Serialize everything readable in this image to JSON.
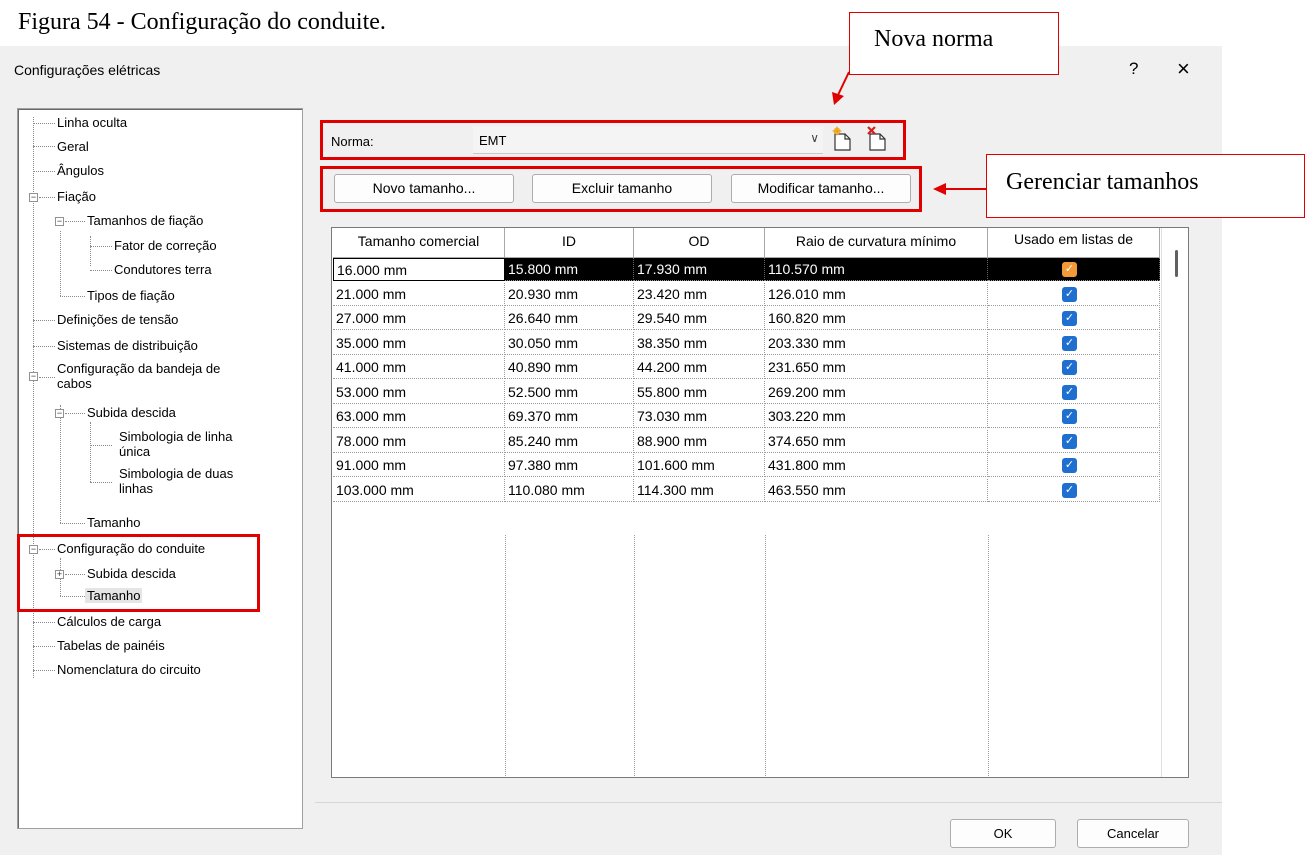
{
  "caption": "Figura 54 - Configuração do conduite.",
  "dialog": {
    "title": "Configurações elétricas",
    "help": "?",
    "close": "×"
  },
  "tree": {
    "items": [
      {
        "label": "Linha oculta"
      },
      {
        "label": "Geral"
      },
      {
        "label": "Ângulos"
      },
      {
        "label": "Fiação"
      },
      {
        "label": "Tamanhos de fiação"
      },
      {
        "label": "Fator de correção"
      },
      {
        "label": "Condutores terra"
      },
      {
        "label": "Tipos de fiação"
      },
      {
        "label": "Definições de tensão"
      },
      {
        "label": "Sistemas de distribuição"
      },
      {
        "label_line1": "Configuração da bandeja de",
        "label_line2": "cabos"
      },
      {
        "label": "Subida descida"
      },
      {
        "label_line1": "Simbologia de linha",
        "label_line2": "única"
      },
      {
        "label_line1": "Simbologia de duas",
        "label_line2": "linhas"
      },
      {
        "label": "Tamanho"
      },
      {
        "label": "Configuração do conduite"
      },
      {
        "label": "Subida descida"
      },
      {
        "label": "Tamanho",
        "selected": true
      },
      {
        "label": "Cálculos de carga"
      },
      {
        "label": "Tabelas de painéis"
      },
      {
        "label": "Nomenclatura do circuito"
      }
    ]
  },
  "norma": {
    "label": "Norma:",
    "value": "EMT",
    "new_icon": "new-norm-icon",
    "delete_icon": "delete-norm-icon"
  },
  "buttons": {
    "new_size": "Novo tamanho...",
    "delete_size": "Excluir tamanho",
    "modify_size": "Modificar tamanho..."
  },
  "table": {
    "headers": [
      "Tamanho comercial",
      "ID",
      "OD",
      "Raio de curvatura mínimo",
      "Usado em listas de"
    ],
    "rows": [
      {
        "size": "16.000 mm",
        "id": "15.800 mm",
        "od": "17.930 mm",
        "radius": "110.570 mm",
        "used": true
      },
      {
        "size": "21.000 mm",
        "id": "20.930 mm",
        "od": "23.420 mm",
        "radius": "126.010 mm",
        "used": true
      },
      {
        "size": "27.000 mm",
        "id": "26.640 mm",
        "od": "29.540 mm",
        "radius": "160.820 mm",
        "used": true
      },
      {
        "size": "35.000 mm",
        "id": "30.050 mm",
        "od": "38.350 mm",
        "radius": "203.330 mm",
        "used": true
      },
      {
        "size": "41.000 mm",
        "id": "40.890 mm",
        "od": "44.200 mm",
        "radius": "231.650 mm",
        "used": true
      },
      {
        "size": "53.000 mm",
        "id": "52.500 mm",
        "od": "55.800 mm",
        "radius": "269.200 mm",
        "used": true
      },
      {
        "size": "63.000 mm",
        "id": "69.370 mm",
        "od": "73.030 mm",
        "radius": "303.220 mm",
        "used": true
      },
      {
        "size": "78.000 mm",
        "id": "85.240 mm",
        "od": "88.900 mm",
        "radius": "374.650 mm",
        "used": true
      },
      {
        "size": "91.000 mm",
        "id": "97.380 mm",
        "od": "101.600 mm",
        "radius": "431.800 mm",
        "used": true
      },
      {
        "size": "103.000 mm",
        "id": "110.080 mm",
        "od": "114.300 mm",
        "radius": "463.550 mm",
        "used": true
      }
    ]
  },
  "footer": {
    "ok": "OK",
    "cancel": "Cancelar"
  },
  "annotations": {
    "new_norm": "Nova norma",
    "manage_sizes": "Gerenciar tamanhos"
  },
  "colors": {
    "annotation_red": "#e00000",
    "checkbox_blue": "#1f6fd1",
    "checkbox_selected_orange": "#f29a38",
    "selection_black": "#000000"
  }
}
